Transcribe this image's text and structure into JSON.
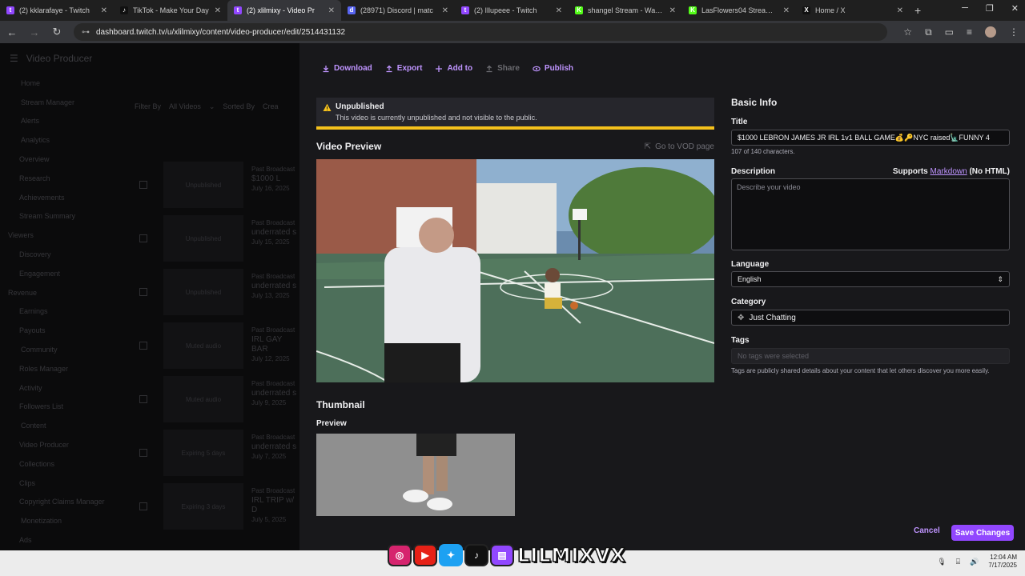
{
  "browser": {
    "tabs": [
      {
        "title": "(2) kklarafaye - Twitch",
        "color": "#9147ff",
        "glyph": "t",
        "active": false
      },
      {
        "title": "TikTok - Make Your Day",
        "color": "#111111",
        "glyph": "♪",
        "active": false
      },
      {
        "title": "(2) xlilmixy - Video Pr",
        "color": "#9147ff",
        "glyph": "t",
        "active": true
      },
      {
        "title": "(28971) Discord | matc",
        "color": "#5865f2",
        "glyph": "d",
        "active": false
      },
      {
        "title": "(2) Illupeee - Twitch",
        "color": "#9147ff",
        "glyph": "t",
        "active": false
      },
      {
        "title": "shangel Stream - Watch L",
        "color": "#53fc18",
        "glyph": "K",
        "active": false
      },
      {
        "title": "LasFlowers04 Stream - Wa",
        "color": "#53fc18",
        "glyph": "K",
        "active": false
      },
      {
        "title": "Home / X",
        "color": "#111111",
        "glyph": "X",
        "active": false
      }
    ],
    "url": "dashboard.twitch.tv/u/xlilmixy/content/video-producer/edit/2514431132"
  },
  "background": {
    "title": "Video Producer",
    "nav": [
      {
        "label": "Home",
        "kind": "sec"
      },
      {
        "label": "Stream Manager",
        "kind": "sec"
      },
      {
        "label": "Alerts",
        "kind": "sec"
      },
      {
        "label": "Analytics",
        "kind": "sec"
      },
      {
        "label": "Overview",
        "kind": "sub"
      },
      {
        "label": "Research",
        "kind": "sub"
      },
      {
        "label": "Achievements",
        "kind": "sub"
      },
      {
        "label": "Stream Summary",
        "kind": "sub"
      },
      {
        "label": "Viewers",
        "kind": "plain"
      },
      {
        "label": "Discovery",
        "kind": "sub"
      },
      {
        "label": "Engagement",
        "kind": "sub"
      },
      {
        "label": "Revenue",
        "kind": "plain"
      },
      {
        "label": "Earnings",
        "kind": "sub"
      },
      {
        "label": "Payouts",
        "kind": "sub"
      },
      {
        "label": "Community",
        "kind": "sec"
      },
      {
        "label": "Roles Manager",
        "kind": "sub"
      },
      {
        "label": "Activity",
        "kind": "sub"
      },
      {
        "label": "Followers List",
        "kind": "sub"
      },
      {
        "label": "Content",
        "kind": "sec"
      },
      {
        "label": "Video Producer",
        "kind": "sub"
      },
      {
        "label": "Collections",
        "kind": "sub"
      },
      {
        "label": "Clips",
        "kind": "sub"
      },
      {
        "label": "Copyright Claims Manager",
        "kind": "sub"
      },
      {
        "label": "Monetization",
        "kind": "sec"
      },
      {
        "label": "Ads",
        "kind": "sub"
      }
    ],
    "filter_by": "Filter By",
    "filter_value": "All Videos",
    "sorted_by": "Sorted By",
    "sorted_value": "Crea",
    "rows": [
      {
        "status": "Unpublished",
        "type": "Past Broadcast",
        "title": "$1000 L",
        "date": "July 16, 2025"
      },
      {
        "status": "Unpublished",
        "type": "Past Broadcast",
        "title": "underrated s",
        "date": "July 15, 2025"
      },
      {
        "status": "Unpublished",
        "type": "Past Broadcast",
        "title": "underrated s",
        "date": "July 13, 2025"
      },
      {
        "status": "Muted audio",
        "type": "Past Broadcast",
        "title": "IRL GAY BAR",
        "date": "July 12, 2025"
      },
      {
        "status": "Muted audio",
        "type": "Past Broadcast",
        "title": "underrated s",
        "date": "July 9, 2025"
      },
      {
        "status": "Expiring 5 days",
        "type": "Past Broadcast",
        "title": "underrated s",
        "date": "July 7, 2025"
      },
      {
        "status": "Expiring 3 days",
        "type": "Past Broadcast",
        "title": "IRL TRIP w/ D",
        "date": "July 5, 2025"
      }
    ]
  },
  "toolbar": {
    "download": "Download",
    "export": "Export",
    "add_to": "Add to",
    "share": "Share",
    "publish": "Publish"
  },
  "warning": {
    "title": "Unpublished",
    "text": "This video is currently unpublished and not visible to the public."
  },
  "preview": {
    "title": "Video Preview",
    "vod_link": "Go to VOD page"
  },
  "thumbnail": {
    "title": "Thumbnail",
    "preview_label": "Preview"
  },
  "form": {
    "heading": "Basic Info",
    "title_label": "Title",
    "title_value": "$1000 LEBRON JAMES JR IRL 1v1 BALL GAME💰🔑NYC raised🗽FUNNY 4",
    "char_count": "107 of 140 characters.",
    "description_label": "Description",
    "supports": "Supports",
    "markdown": "Markdown",
    "no_html": "(No HTML)",
    "description_placeholder": "Describe your video",
    "language_label": "Language",
    "language_value": "English",
    "category_label": "Category",
    "category_value": "Just Chatting",
    "tags_label": "Tags",
    "tags_placeholder": "No tags were selected",
    "tags_help": "Tags are publicly shared details about your content that let others discover you more easily."
  },
  "footer": {
    "cancel": "Cancel",
    "save": "Save Changes"
  },
  "overlay": {
    "brand": "LILMIXVX",
    "time": "12:04 AM",
    "date": "7/17/2025"
  },
  "colors": {
    "accent": "#9147ff",
    "link": "#bf94ff",
    "warning": "#f5c11c"
  }
}
